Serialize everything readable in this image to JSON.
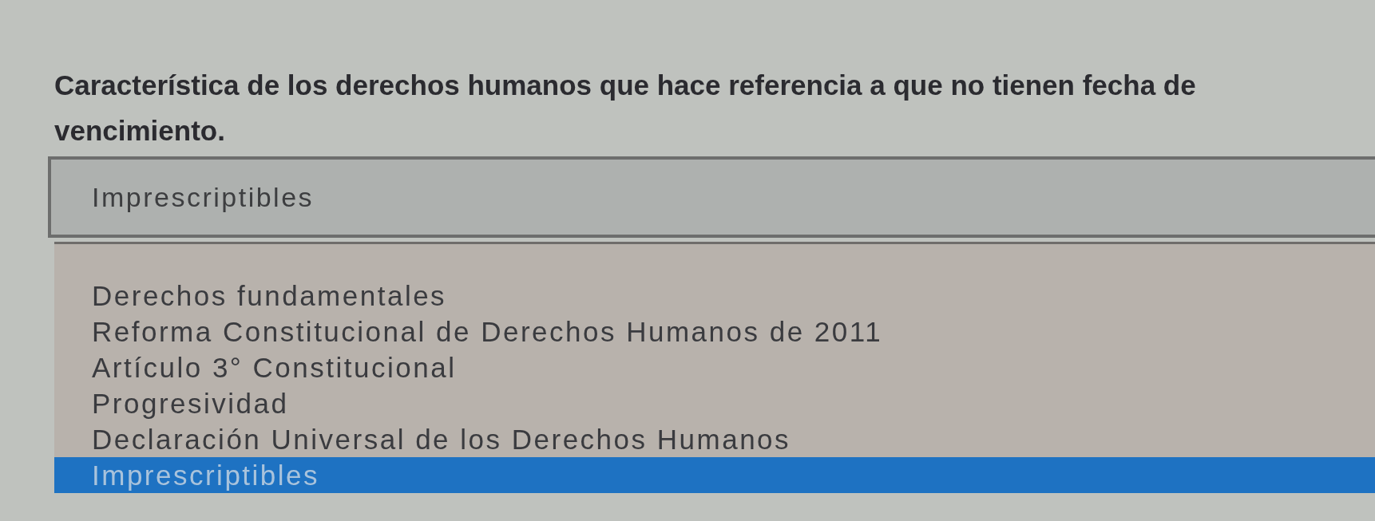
{
  "question": {
    "text": "Característica de los derechos humanos que hace referencia a que no tienen fecha de vencimiento."
  },
  "select": {
    "value": "Imprescriptibles",
    "expanded": true
  },
  "options": [
    {
      "label": "Derechos fundamentales",
      "selected": false
    },
    {
      "label": "Reforma Constitucional de Derechos Humanos de 2011",
      "selected": false
    },
    {
      "label": "Artículo 3° Constitucional",
      "selected": false
    },
    {
      "label": "Progresividad",
      "selected": false
    },
    {
      "label": "Declaración Universal de los Derechos Humanos",
      "selected": false
    },
    {
      "label": "Imprescriptibles",
      "selected": true
    }
  ]
}
